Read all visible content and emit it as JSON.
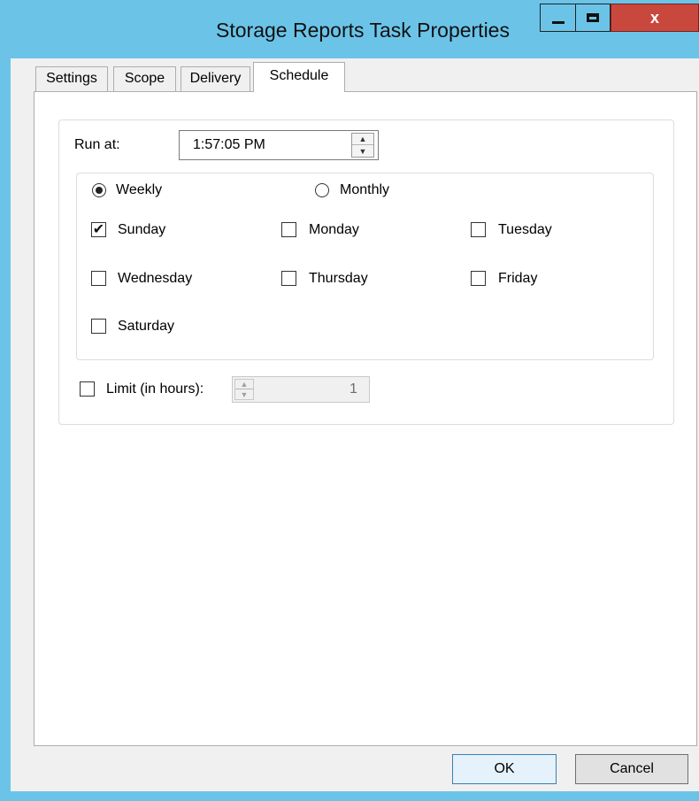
{
  "window": {
    "title": "Storage Reports Task Properties",
    "close_label": "x"
  },
  "tabs": [
    {
      "label": "Settings"
    },
    {
      "label": "Scope"
    },
    {
      "label": "Delivery"
    },
    {
      "label": "Schedule",
      "selected": true
    }
  ],
  "schedule": {
    "run_at_label": "Run at:",
    "run_at_value": "1:57:05 PM",
    "frequency": {
      "weekly_label": "Weekly",
      "monthly_label": "Monthly",
      "selected": "Weekly"
    },
    "days": [
      {
        "label": "Sunday",
        "checked": true
      },
      {
        "label": "Monday",
        "checked": false
      },
      {
        "label": "Tuesday",
        "checked": false
      },
      {
        "label": "Wednesday",
        "checked": false
      },
      {
        "label": "Thursday",
        "checked": false
      },
      {
        "label": "Friday",
        "checked": false
      },
      {
        "label": "Saturday",
        "checked": false
      }
    ],
    "limit_label": "Limit (in hours):",
    "limit_checked": false,
    "limit_value": "1"
  },
  "buttons": {
    "ok": "OK",
    "cancel": "Cancel"
  },
  "colors": {
    "title_bar": "#6bc4e8",
    "close_button": "#c9483e"
  }
}
